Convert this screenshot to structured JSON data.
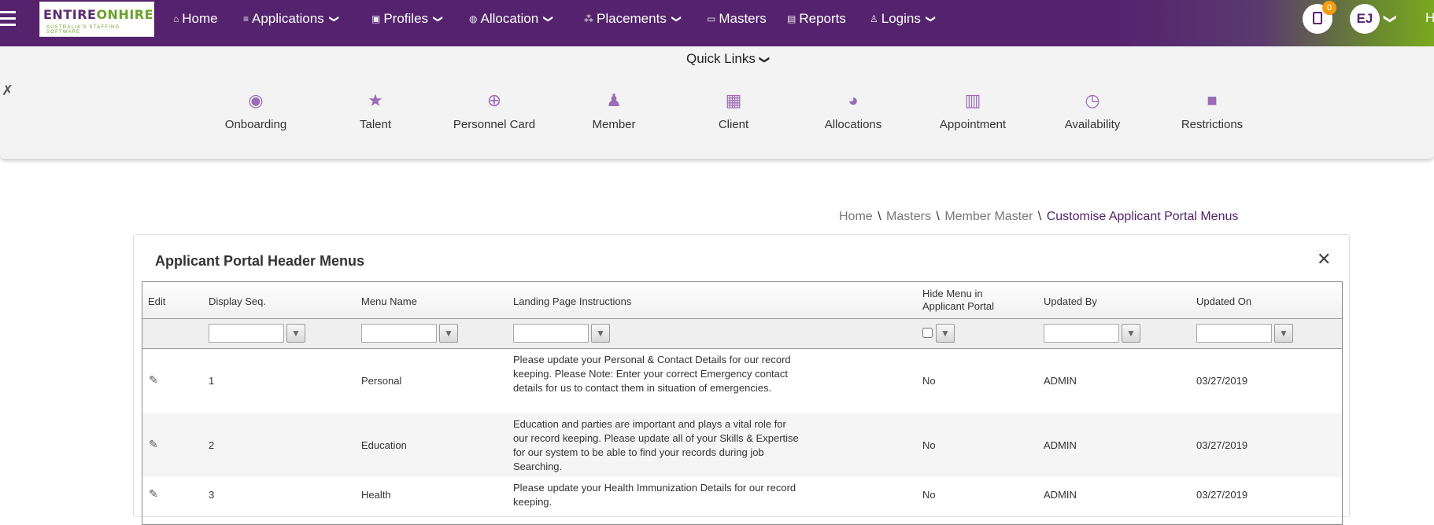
{
  "logo": {
    "part1": "ENTIRE",
    "part2": "ONHIRE",
    "tagline": "AUSTRALIA'S STAFFING SOFTWARE"
  },
  "nav": {
    "home": "Home",
    "applications": "Applications",
    "profiles": "Profiles",
    "allocation": "Allocation",
    "placements": "Placements",
    "masters": "Masters",
    "reports": "Reports",
    "logins": "Logins"
  },
  "user": {
    "initials": "EJ",
    "notification_count": "0",
    "edge_text": "H"
  },
  "quick_links": {
    "title": "Quick Links",
    "items": [
      {
        "label": "Onboarding",
        "icon": "user-circle-icon"
      },
      {
        "label": "Talent",
        "icon": "star-icon"
      },
      {
        "label": "Personnel Card",
        "icon": "search-plus-icon"
      },
      {
        "label": "Member",
        "icon": "user-icon"
      },
      {
        "label": "Client",
        "icon": "building-icon"
      },
      {
        "label": "Allocations",
        "icon": "pie-chart-icon"
      },
      {
        "label": "Appointment",
        "icon": "calendar-icon"
      },
      {
        "label": "Availability",
        "icon": "clock-icon"
      },
      {
        "label": "Restrictions",
        "icon": "lock-icon"
      }
    ]
  },
  "breadcrumb": {
    "home": "Home",
    "masters": "Masters",
    "member_master": "Member Master",
    "current": "Customise Applicant Portal Menus",
    "sep": "\\"
  },
  "panel": {
    "title": "Applicant Portal Header Menus",
    "columns": {
      "edit": "Edit",
      "display_seq": "Display Seq.",
      "menu_name": "Menu Name",
      "landing": "Landing Page Instructions",
      "hide_line1": "Hide Menu in",
      "hide_line2": "Applicant Portal",
      "updated_by": "Updated By",
      "updated_on": "Updated On"
    },
    "rows": [
      {
        "seq": "1",
        "menu": "Personal",
        "instructions": "Please update your Personal & Contact Details for our record keeping. Please Note: Enter your correct Emergency contact details for us to contact them in situation of emergencies.",
        "hide": "No",
        "updated_by": "ADMIN",
        "updated_on": "03/27/2019"
      },
      {
        "seq": "2",
        "menu": "Education",
        "instructions": "Education and parties are important and plays a vital role for our record keeping. Please update all of your Skills & Expertise for our system to be able to find your records during job Searching.",
        "hide": "No",
        "updated_by": "ADMIN",
        "updated_on": "03/27/2019"
      },
      {
        "seq": "3",
        "menu": "Health",
        "instructions": "Please update your Health Immunization Details for our record keeping.",
        "hide": "No",
        "updated_by": "ADMIN",
        "updated_on": "03/27/2019"
      }
    ]
  }
}
